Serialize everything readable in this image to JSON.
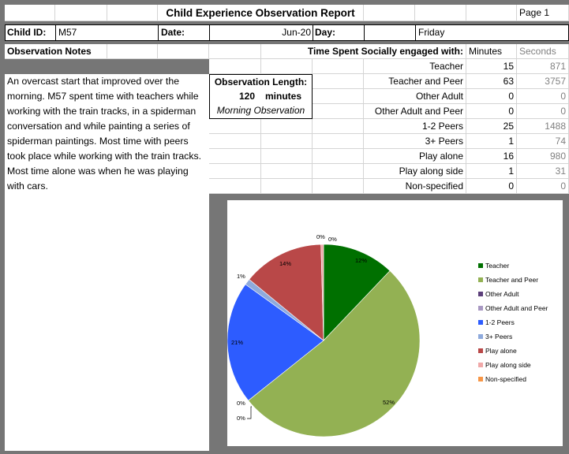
{
  "report": {
    "title": "Child Experience Observation Report",
    "page_label": "Page 1",
    "child_id_label": "Child ID:",
    "child_id_value": "M57",
    "date_label": "Date:",
    "date_value": "Jun-20",
    "day_label": "Day:",
    "day_value": "Friday",
    "notes_heading": "Observation Notes",
    "notes_text": "An overcast start that improved over the morning. M57 spent time with teachers while working with the train tracks,  in a spiderman conversation and while  painting a series of spiderman paintings.  Most time with peers took place while working with the train tracks. Most time alone was when he was playing with cars.",
    "obs_length_label": "Observation Length:",
    "obs_length_value": "120",
    "obs_length_unit": "minutes",
    "obs_period": "Morning Observation"
  },
  "table": {
    "heading": "Time Spent Socially engaged with:",
    "col_minutes": "Minutes",
    "col_seconds": "Seconds",
    "rows": [
      {
        "label": "Teacher",
        "minutes": "15",
        "seconds": "871"
      },
      {
        "label": "Teacher and Peer",
        "minutes": "63",
        "seconds": "3757"
      },
      {
        "label": "Other Adult",
        "minutes": "0",
        "seconds": "0"
      },
      {
        "label": "Other Adult and Peer",
        "minutes": "0",
        "seconds": "0"
      },
      {
        "label": "1-2 Peers",
        "minutes": "25",
        "seconds": "1488"
      },
      {
        "label": "3+ Peers",
        "minutes": "1",
        "seconds": "74"
      },
      {
        "label": "Play alone",
        "minutes": "16",
        "seconds": "980"
      },
      {
        "label": "Play along side",
        "minutes": "1",
        "seconds": "31"
      },
      {
        "label": "Non-specified",
        "minutes": "0",
        "seconds": "0"
      }
    ]
  },
  "chart_data": {
    "type": "pie",
    "title": "",
    "legend_position": "right",
    "categories": [
      "Teacher",
      "Teacher and Peer",
      "Other Adult",
      "Other Adult and Peer",
      "1-2 Peers",
      "3+ Peers",
      "Play alone",
      "Play along side",
      "Non-specified"
    ],
    "values": [
      871,
      3757,
      0,
      0,
      1488,
      74,
      980,
      31,
      0
    ],
    "labels": [
      "12%",
      "52%",
      "0%",
      "0%",
      "21%",
      "1%",
      "14%",
      "0%",
      "0%"
    ],
    "colors": [
      "#007000",
      "#93b153",
      "#5c3f7a",
      "#a898c2",
      "#2d5cff",
      "#8eaadc",
      "#b94848",
      "#f0a8a8",
      "#f79646"
    ]
  }
}
